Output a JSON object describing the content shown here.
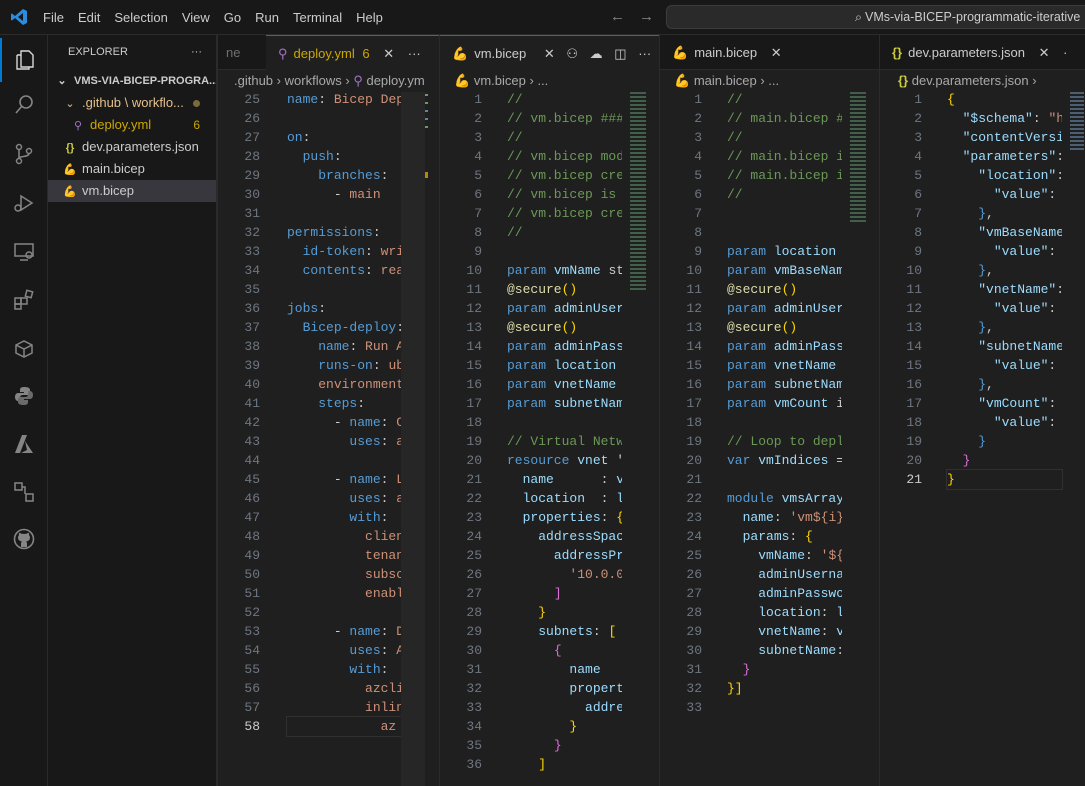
{
  "titlebar": {
    "menu": [
      "File",
      "Edit",
      "Selection",
      "View",
      "Go",
      "Run",
      "Terminal",
      "Help"
    ],
    "search_text": "VMs-via-BICEP-programmatic-iterative"
  },
  "sidebar": {
    "title": "EXPLORER",
    "root": "VMS-VIA-BICEP-PROGRA...",
    "items": [
      {
        "label": ".github \\ workflo...",
        "icon": "chevron-down-icon"
      },
      {
        "label": "deploy.yml",
        "badge": "6",
        "icon": "yaml-file-icon"
      },
      {
        "label": "dev.parameters.json",
        "icon": "json-file-icon"
      },
      {
        "label": "main.bicep",
        "icon": "bicep-file-icon"
      },
      {
        "label": "vm.bicep",
        "icon": "bicep-file-icon"
      }
    ]
  },
  "pane1": {
    "prev_tab": "ne",
    "tab_label": "deploy.yml",
    "tab_badge": "6",
    "crumbs": [
      ".github",
      "workflows",
      "deploy.ym"
    ],
    "line_start": 25,
    "current_line": 58,
    "lines": [
      "name: Bicep Dep",
      "",
      "on:",
      "  push:",
      "    branches:",
      "      - main",
      "",
      "permissions:",
      "  id-token: wri",
      "  contents: rea",
      "",
      "jobs:",
      "  Bicep-deploy:",
      "    name: Run A",
      "    runs-on: ub",
      "    environment",
      "    steps:",
      "      - name: C",
      "        uses: a",
      "",
      "      - name: L",
      "        uses: a",
      "        with:",
      "          clien",
      "          tenan",
      "          subsc",
      "          enabl",
      "",
      "      - name: D",
      "        uses: A",
      "        with:",
      "          azcli",
      "          inlin",
      "            az "
    ]
  },
  "pane2": {
    "tab_label": "vm.bicep",
    "crumbs": [
      "vm.bicep",
      "..."
    ],
    "line_start": 1,
    "lines": [
      "//",
      "// vm.bicep ###",
      "//",
      "// vm.bicep mod",
      "// vm.bicep cre",
      "// vm.bicep is ",
      "// vm.bicep cre",
      "//",
      "",
      "param vmName st",
      "@secure()",
      "param adminUser",
      "@secure()",
      "param adminPass",
      "param location ",
      "param vnetName ",
      "param subnetNam",
      "",
      "// Virtual Netw",
      "resource vnet '",
      "  name      : v",
      "  location  : l",
      "  properties: {",
      "    addressSpac",
      "      addressPr",
      "        '10.0.0",
      "      ]",
      "    }",
      "    subnets: [",
      "      {",
      "        name",
      "        propert",
      "          addre",
      "        }",
      "      }",
      "    ]"
    ]
  },
  "pane3": {
    "tab_label": "main.bicep",
    "crumbs": [
      "main.bicep",
      "..."
    ],
    "line_start": 1,
    "lines": [
      "//",
      "// main.bicep #",
      "//",
      "// main.bicep i",
      "// main.bicep i",
      "//",
      "",
      "",
      "param location ",
      "param vmBaseNam",
      "@secure()",
      "param adminUser",
      "@secure()",
      "param adminPass",
      "param vnetName ",
      "param subnetNam",
      "param vmCount i",
      "",
      "// Loop to depl",
      "var vmIndices =",
      "",
      "module vmsArray",
      "  name: 'vm${i}",
      "  params: {",
      "    vmName: '${",
      "    adminUserna",
      "    adminPasswo",
      "    location: l",
      "    vnetName: v",
      "    subnetName:",
      "  }",
      "}]",
      ""
    ]
  },
  "pane4": {
    "tab_label": "dev.parameters.json",
    "crumbs": [
      "dev.parameters.json",
      ""
    ],
    "line_start": 1,
    "current_line": 21,
    "lines": [
      "{",
      "  \"$schema\": \"h",
      "  \"contentVersi",
      "  \"parameters\":",
      "    \"location\":",
      "      \"value\": ",
      "    },",
      "    \"vmBaseName",
      "      \"value\": ",
      "    },",
      "    \"vnetName\":",
      "      \"value\": ",
      "    },",
      "    \"subnetName",
      "      \"value\": ",
      "    },",
      "    \"vmCount\":",
      "      \"value\": ",
      "    }",
      "  }",
      "}"
    ]
  }
}
